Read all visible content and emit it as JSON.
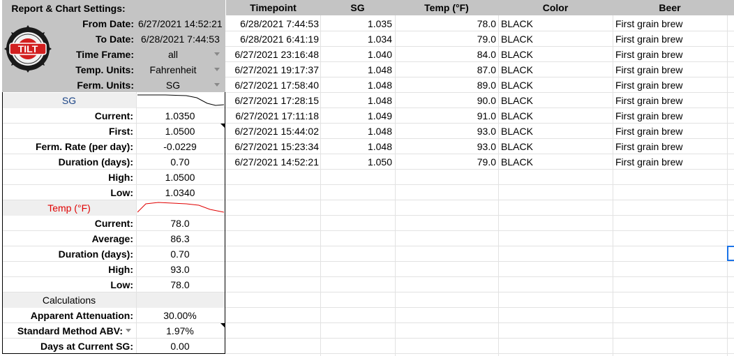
{
  "settings": {
    "title": "Report & Chart Settings:",
    "from_label": "From Date:",
    "from_value": "6/27/2021 14:52:21",
    "to_label": "To Date:",
    "to_value": "6/28/2021 7:44:53",
    "timeframe_label": "Time Frame:",
    "timeframe_value": "all",
    "temp_units_label": "Temp. Units:",
    "temp_units_value": "Fahrenheit",
    "ferm_units_label": "Ferm. Units:",
    "ferm_units_value": "SG",
    "logo_text": "TILT"
  },
  "sg": {
    "header": "SG",
    "rows": [
      {
        "label": "Current:",
        "value": "1.0350"
      },
      {
        "label": "First:",
        "value": "1.0500"
      },
      {
        "label": "Ferm. Rate (per day):",
        "value": "-0.0229"
      },
      {
        "label": "Duration (days):",
        "value": "0.70"
      },
      {
        "label": "High:",
        "value": "1.0500"
      },
      {
        "label": "Low:",
        "value": "1.0340"
      }
    ]
  },
  "temp": {
    "header": "Temp (°F)",
    "rows": [
      {
        "label": "Current:",
        "value": "78.0"
      },
      {
        "label": "Average:",
        "value": "86.3"
      },
      {
        "label": "Duration (days):",
        "value": "0.70"
      },
      {
        "label": "High:",
        "value": "93.0"
      },
      {
        "label": "Low:",
        "value": "78.0"
      }
    ]
  },
  "calc": {
    "header": "Calculations",
    "rows": [
      {
        "label": "Apparent Attenuation:",
        "value": "30.00%"
      },
      {
        "label": "Standard Method ABV:",
        "value": "1.97%"
      },
      {
        "label": "Days at Current SG:",
        "value": "0.00"
      }
    ]
  },
  "table": {
    "headers": [
      "Timepoint",
      "SG",
      "Temp (°F)",
      "Color",
      "Beer"
    ],
    "rows": [
      [
        "6/28/2021 7:44:53",
        "1.035",
        "78.0",
        "BLACK",
        "First grain brew"
      ],
      [
        "6/28/2021 6:41:19",
        "1.034",
        "79.0",
        "BLACK",
        "First grain brew"
      ],
      [
        "6/27/2021 23:16:48",
        "1.040",
        "84.0",
        "BLACK",
        "First grain brew"
      ],
      [
        "6/27/2021 19:17:37",
        "1.048",
        "87.0",
        "BLACK",
        "First grain brew"
      ],
      [
        "6/27/2021 17:58:40",
        "1.048",
        "89.0",
        "BLACK",
        "First grain brew"
      ],
      [
        "6/27/2021 17:28:15",
        "1.048",
        "90.0",
        "BLACK",
        "First grain brew"
      ],
      [
        "6/27/2021 17:11:18",
        "1.049",
        "91.0",
        "BLACK",
        "First grain brew"
      ],
      [
        "6/27/2021 15:44:02",
        "1.048",
        "93.0",
        "BLACK",
        "First grain brew"
      ],
      [
        "6/27/2021 15:23:34",
        "1.048",
        "93.0",
        "BLACK",
        "First grain brew"
      ],
      [
        "6/27/2021 14:52:21",
        "1.050",
        "79.0",
        "BLACK",
        "First grain brew"
      ]
    ]
  },
  "colors": {
    "header_bg": "#c4c4c4",
    "section_bg": "#efefef",
    "sg_header": "#1c4587",
    "temp_header": "#e00000",
    "selection": "#1a73e8"
  }
}
